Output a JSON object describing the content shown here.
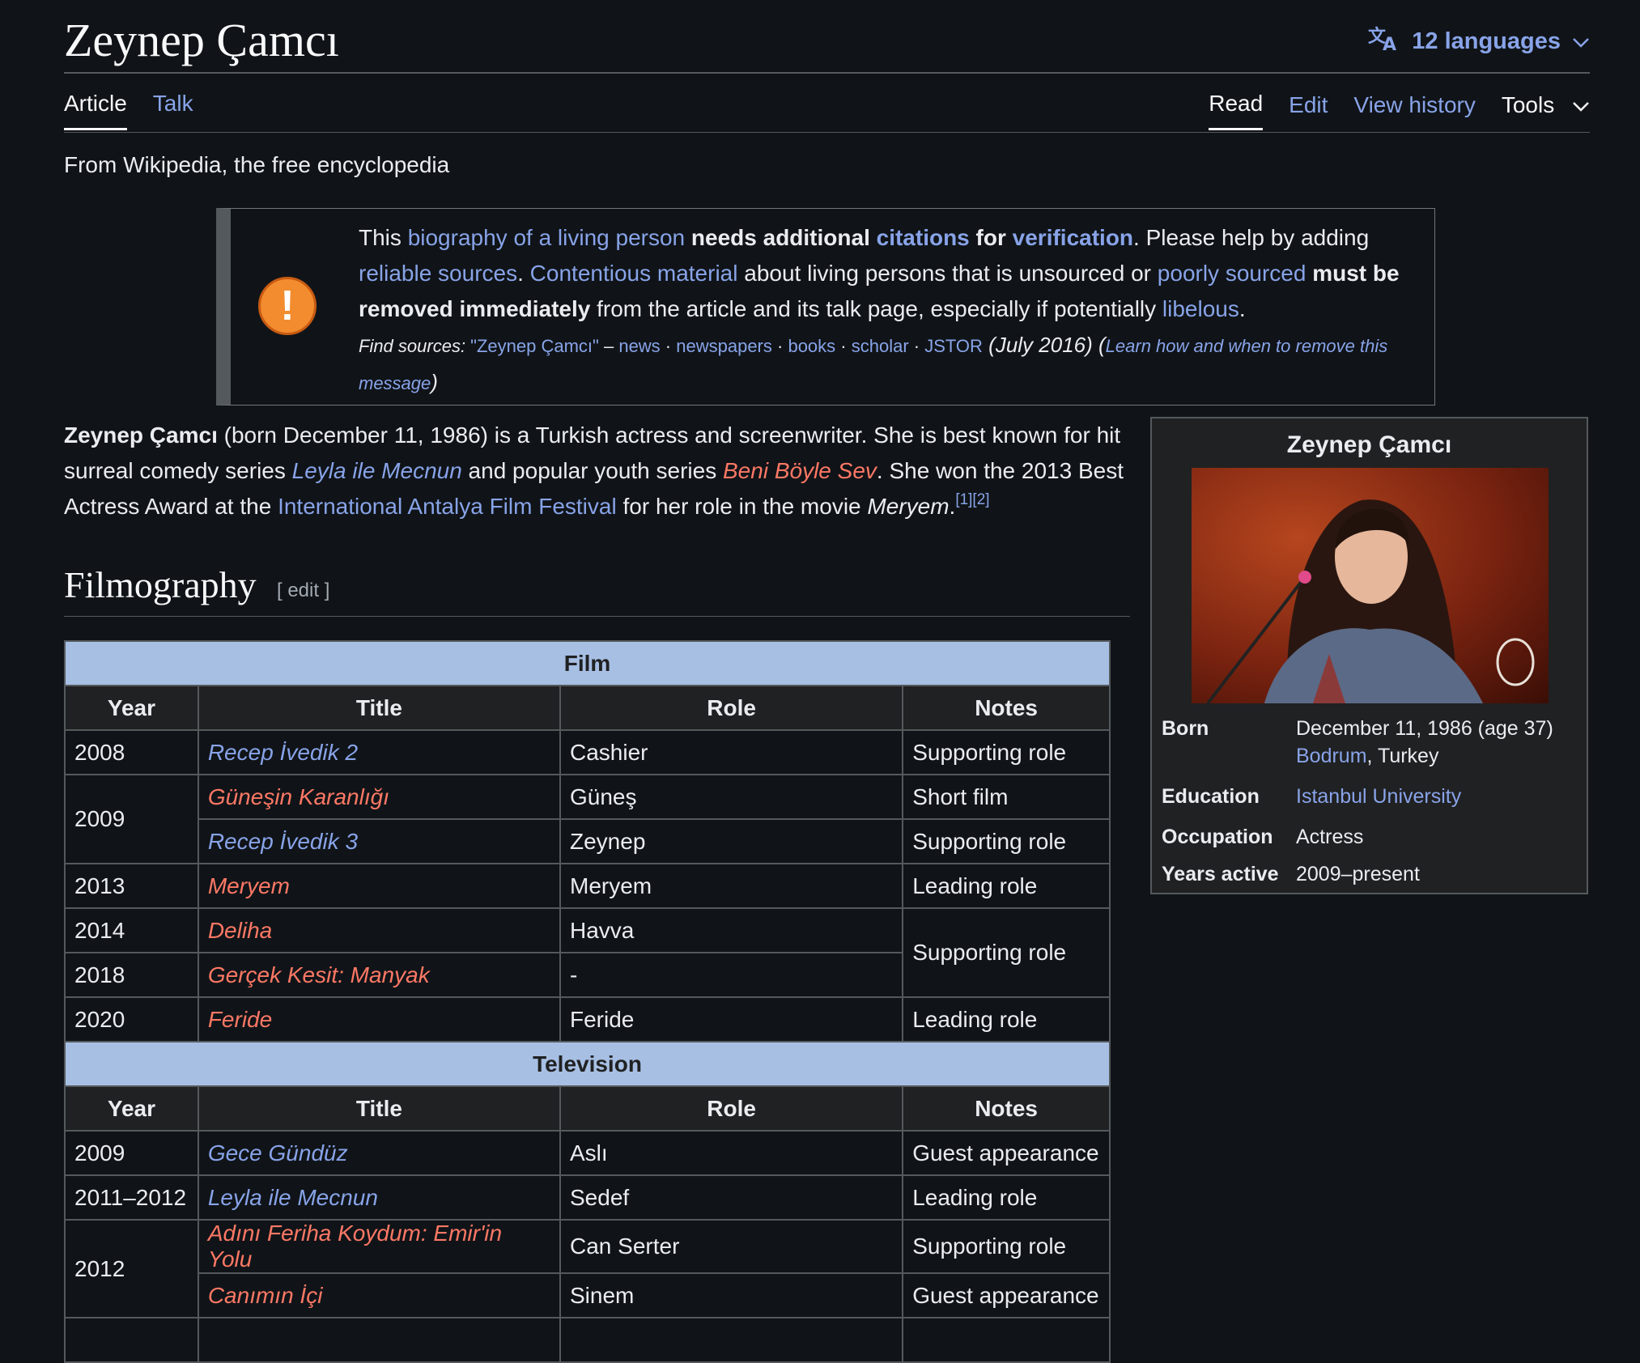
{
  "page": {
    "title": "Zeynep Çamcı",
    "languages": "12 languages",
    "tagline": "From Wikipedia, the free encyclopedia"
  },
  "tabs": {
    "article": "Article",
    "talk": "Talk",
    "read": "Read",
    "edit": "Edit",
    "history": "View history",
    "tools": "Tools"
  },
  "notice": {
    "t1": "This ",
    "l1": "biography of a living person",
    "b1": " needs additional ",
    "l2": "citations",
    "b2": " for ",
    "l3": "verification",
    "t2": ". Please help by adding ",
    "l4": "reliable sources",
    "t3": ". ",
    "l5": "Contentious material",
    "t4": " about living persons that is unsourced or ",
    "l6": "poorly sourced",
    "b3": " must be removed immediately",
    "t5": " from the article and its talk page, especially if potentially ",
    "l7": "libelous",
    "t6": ".",
    "find_label": "Find sources: ",
    "find_query": "\"Zeynep Çamcı\"",
    "dash": " – ",
    "news": "news",
    "newspapers": "newspapers",
    "books": "books",
    "scholar": "scholar",
    "jstor": "JSTOR",
    "date": " (July 2016) (",
    "learn": "Learn how and when to remove this message",
    "close": ")"
  },
  "lead": {
    "name": "Zeynep Çamcı",
    "t1": " (born December 11, 1986) is a Turkish actress and screenwriter. She is best known for hit surreal comedy series ",
    "s1": "Leyla ile Mecnun",
    "t2": " and popular youth series ",
    "s2": "Beni Böyle Sev",
    "t3": ". She won the 2013 Best Actress Award at the ",
    "festival": "International Antalya Film Festival",
    "t4": " for her role in the movie ",
    "movie": "Meryem",
    "t5": ".",
    "refs": "[1][2]"
  },
  "section": {
    "title": "Filmography",
    "edit": "[ edit ]"
  },
  "table": {
    "film_header": "Film",
    "tv_header": "Television",
    "columns": [
      "Year",
      "Title",
      "Role",
      "Notes"
    ],
    "film": [
      {
        "year": "2008",
        "title": "Recep İvedik 2",
        "role": "Cashier",
        "notes": "Supporting role"
      },
      {
        "year": "2009",
        "title": "Güneşin Karanlığı",
        "role": "Güneş",
        "notes": "Short film"
      },
      {
        "title": "Recep İvedik 3",
        "role": "Zeynep",
        "notes": "Supporting role"
      },
      {
        "year": "2013",
        "title": "Meryem",
        "role": "Meryem",
        "notes": "Leading role"
      },
      {
        "year": "2014",
        "title": "Deliha",
        "role": "Havva",
        "notes": "Supporting role"
      },
      {
        "year": "2018",
        "title": "Gerçek Kesit: Manyak",
        "role": "-"
      },
      {
        "year": "2020",
        "title": "Feride",
        "role": "Feride",
        "notes": "Leading role"
      }
    ],
    "tv": [
      {
        "year": "2009",
        "title": "Gece Gündüz",
        "role": "Aslı",
        "notes": "Guest appearance"
      },
      {
        "year": "2011–2012",
        "title": "Leyla ile Mecnun",
        "role": "Sedef",
        "notes": "Leading role"
      },
      {
        "year": "2012",
        "title": "Adını Feriha Koydum: Emir'in Yolu",
        "role": "Can Serter",
        "notes": "Supporting role"
      },
      {
        "title": "Canımın İçi",
        "role": "Sinem",
        "notes": "Guest appearance"
      }
    ]
  },
  "infobox": {
    "caption": "Zeynep Çamcı",
    "born_label": "Born",
    "born_date": "December 11, 1986 (age 37)",
    "born_place_link": "Bodrum",
    "born_place_rest": ", Turkey",
    "education_label": "Education",
    "education": "Istanbul University",
    "occupation_label": "Occupation",
    "occupation": "Actress",
    "years_label": "Years active",
    "years": "2009–present"
  }
}
